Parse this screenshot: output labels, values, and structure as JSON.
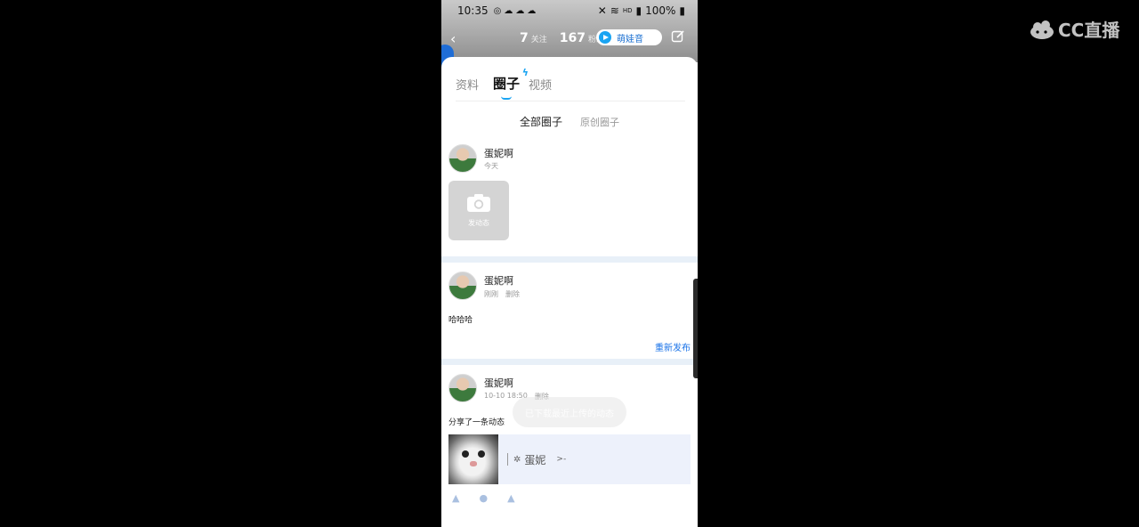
{
  "status_bar": {
    "time": "10:35",
    "battery": "100%",
    "network": "HD"
  },
  "header": {
    "stat1_value": "7",
    "stat1_label": "关注",
    "stat2_value": "167",
    "stat2_label": "粉丝",
    "voice_label": "萌娃音"
  },
  "watermark": {
    "label": "CC直播"
  },
  "tabs": [
    {
      "label": "资料"
    },
    {
      "label": "圈子"
    },
    {
      "label": "视频"
    }
  ],
  "subtabs": [
    {
      "label": "全部圈子"
    },
    {
      "label": "原创圈子"
    }
  ],
  "posts": [
    {
      "username": "蛋妮啊",
      "time": "今天",
      "camera_label": "发动态"
    },
    {
      "username": "蛋妮啊",
      "time": "刚刚",
      "delete_label": "删除",
      "text": "哈哈哈",
      "repost_label": "重新发布"
    },
    {
      "username": "蛋妮啊",
      "time": "10-10 18:50",
      "delete_label": "删除",
      "text": "分享了一条动态",
      "share_name": "蛋妮",
      "share_arrow": ">-"
    }
  ],
  "toast": {
    "text": "已下载最近上传的动态"
  },
  "icons": {
    "back": "chevron-left-icon",
    "edit": "edit-icon",
    "camera": "camera-icon",
    "play": "play-icon"
  },
  "colors": {
    "accent": "#1aa4f2",
    "link": "#1a73e8",
    "separator": "#e8f0f8",
    "share_card": "#edf1fb"
  }
}
